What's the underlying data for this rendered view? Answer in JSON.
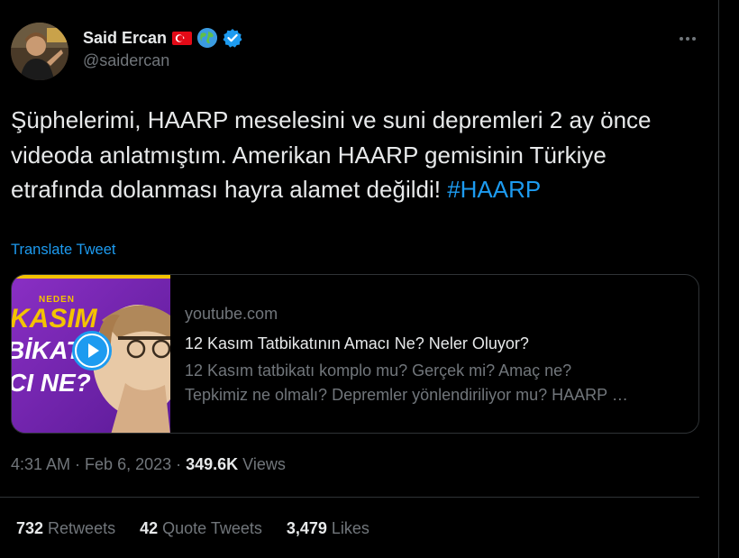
{
  "author": {
    "display_name": "Said Ercan",
    "handle": "@saidercan",
    "badges": [
      "turkey-flag-emoji",
      "globe-emoji",
      "verified-badge"
    ]
  },
  "tweet": {
    "text_plain": "Şüphelerimi, HAARP meselesini ve suni depremleri 2 ay önce videoda anlatmıştım. Amerikan HAARP gemisinin Türkiye etrafında dolanması hayra alamet değildi! ",
    "hashtag": "#HAARP",
    "translate_label": "Translate Tweet"
  },
  "card": {
    "domain": "youtube.com",
    "title": "12 Kasım Tatbikatının Amacı Ne? Neler Oluyor?",
    "description_line1": "12 Kasım tatbikatı komplo mu? Gerçek mi? Amaç ne?",
    "description_line2": "Tepkimiz ne olmalı? Depremler yönlendiriliyor mu? HAARP …",
    "thumbnail_text": {
      "small": "NEDEN",
      "line1": "KASIM",
      "line2": "BİKATI",
      "line3": "CI NE?"
    }
  },
  "meta": {
    "time": "4:31 AM",
    "separator": "·",
    "date": "Feb 6, 2023",
    "views_count": "349.6K",
    "views_label": "Views"
  },
  "stats": {
    "retweets_count": "732",
    "retweets_label": "Retweets",
    "quotes_count": "42",
    "quotes_label": "Quote Tweets",
    "likes_count": "3,479",
    "likes_label": "Likes"
  },
  "colors": {
    "background": "#000000",
    "text_primary": "#e7e9ea",
    "text_secondary": "#71767b",
    "accent": "#1d9bf0",
    "border": "#2f3336"
  }
}
